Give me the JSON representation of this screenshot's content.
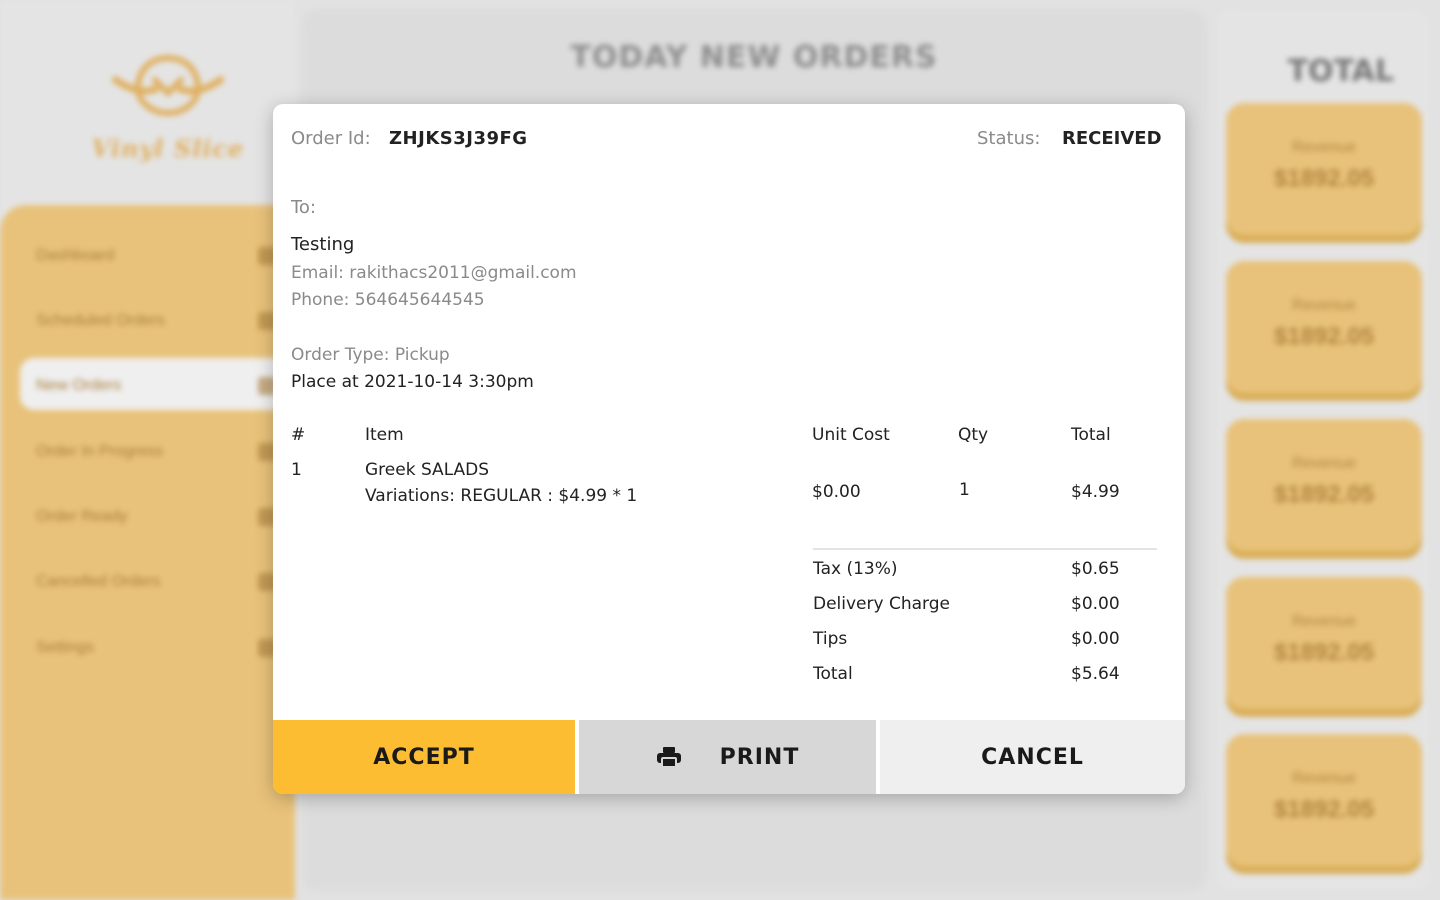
{
  "background": {
    "logo_text": "Vinyl Slice",
    "nav_items": [
      {
        "label": "Dashboard"
      },
      {
        "label": "Scheduled Orders"
      },
      {
        "label": "New Orders"
      },
      {
        "label": "Order In Progress"
      },
      {
        "label": "Order Ready"
      },
      {
        "label": "Cancelled Orders"
      },
      {
        "label": "Settings"
      }
    ],
    "center_title": "TODAY NEW ORDERS",
    "right_title": "TOTAL",
    "revenue_cards": [
      {
        "label": "Revenue",
        "value": "$1892.05"
      },
      {
        "label": "Revenue",
        "value": "$1892.05"
      },
      {
        "label": "Revenue",
        "value": "$1892.05"
      },
      {
        "label": "Revenue",
        "value": "$1892.05"
      },
      {
        "label": "Revenue",
        "value": "$1892.05"
      }
    ],
    "colors": {
      "accent": "#e8c27a",
      "panel": "#dcdcdc"
    }
  },
  "modal": {
    "order_id_label": "Order Id:",
    "order_id": "ZHJKS3J39FG",
    "status_label": "Status:",
    "status": "RECEIVED",
    "to_label": "To:",
    "customer_name": "Testing",
    "email": "Email: rakithacs2011@gmail.com",
    "phone": "Phone: 564645644545",
    "order_type": "Order Type: Pickup",
    "placed_at": "Place at 2021-10-14 3:30pm",
    "table": {
      "headers": {
        "num": "#",
        "item": "Item",
        "unit_cost": "Unit Cost",
        "qty": "Qty",
        "total": "Total"
      },
      "rows": [
        {
          "num": "1",
          "item": "Greek SALADS",
          "variations": "Variations: REGULAR : $4.99 * 1",
          "unit_cost": "$0.00",
          "qty": "1",
          "total": "$4.99"
        }
      ]
    },
    "summary": [
      {
        "label": "Tax (13%)",
        "value": "$0.65"
      },
      {
        "label": "Delivery Charge",
        "value": "$0.00"
      },
      {
        "label": "Tips",
        "value": "$0.00"
      },
      {
        "label": "Total",
        "value": "$5.64"
      }
    ],
    "buttons": {
      "accept": "ACCEPT",
      "print": "PRINT",
      "cancel": "CANCEL",
      "print_icon": "printer-icon"
    },
    "colors": {
      "accept": "#fcbd32",
      "print": "#d7d7d7",
      "cancel": "#efefef"
    }
  }
}
